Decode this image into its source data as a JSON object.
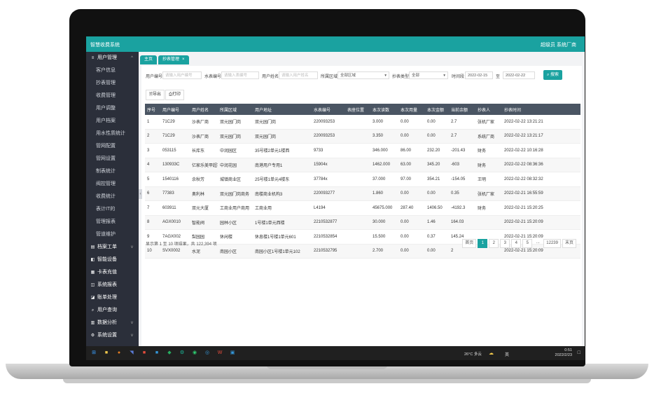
{
  "app": {
    "title": "智慧收费系统",
    "user": "超级员 系统厂商"
  },
  "colors": {
    "accent": "#1aa2a0",
    "sidebar": "#2b2f3a",
    "header": "#4a5563"
  },
  "sidebar": {
    "items": [
      {
        "label": "用户管理",
        "type": "group",
        "icon": "list-icon",
        "chev": "^"
      },
      {
        "label": "客户信息",
        "type": "sub"
      },
      {
        "label": "抄表管理",
        "type": "sub"
      },
      {
        "label": "收费管理",
        "type": "sub"
      },
      {
        "label": "用户调整",
        "type": "sub"
      },
      {
        "label": "用户档案",
        "type": "sub"
      },
      {
        "label": "用水性质统计",
        "type": "sub"
      },
      {
        "label": "管网配置",
        "type": "sub"
      },
      {
        "label": "管网设置",
        "type": "sub"
      },
      {
        "label": "制表统计",
        "type": "sub"
      },
      {
        "label": "阀控管理",
        "type": "sub"
      },
      {
        "label": "收费统计",
        "type": "sub"
      },
      {
        "label": "表计IT的",
        "type": "sub"
      },
      {
        "label": "管理报表",
        "type": "sub"
      },
      {
        "label": "管道维护",
        "type": "sub"
      },
      {
        "label": "档案工单",
        "type": "group",
        "icon": "doc-icon",
        "chev": "v"
      },
      {
        "label": "智能设备",
        "type": "group",
        "icon": "device-icon"
      },
      {
        "label": "卡表充值",
        "type": "group",
        "icon": "card-icon"
      },
      {
        "label": "系统报表",
        "type": "group",
        "icon": "report-icon"
      },
      {
        "label": "账单处理",
        "type": "group",
        "icon": "bill-icon"
      },
      {
        "label": "用户查询",
        "type": "group",
        "icon": "search-icon"
      },
      {
        "label": "数据分析",
        "type": "group",
        "icon": "chart-icon",
        "chev": "v"
      },
      {
        "label": "系统设置",
        "type": "group",
        "icon": "gear-icon",
        "chev": "v"
      }
    ]
  },
  "tabs": [
    {
      "label": "主页"
    },
    {
      "label": "抄表管理",
      "close": "×"
    }
  ],
  "filters": {
    "user_no_label": "用户编号",
    "user_no_placeholder": "请输入用户编号",
    "meter_no_label": "水表编号",
    "meter_no_placeholder": "请输入表编号",
    "user_name_label": "用户姓名",
    "user_name_placeholder": "请输入用户姓名",
    "area_label": "所属区域",
    "area_value": "全部区域",
    "meter_type_label": "抄表类型",
    "meter_type_value": "全部",
    "date_label": "时间段",
    "date_from": "2022-02-15",
    "date_to": "2022-02-22",
    "date_sep": "至",
    "search": "搜索"
  },
  "toolbar": {
    "export": "导出",
    "print": "打印"
  },
  "table": {
    "headers": [
      "序号",
      "用户编号",
      "用户姓名",
      "所属区域",
      "用户地址",
      "水表编号",
      "表座位置",
      "本次读数",
      "本次用量",
      "本次金额",
      "当前余额",
      "抄表人",
      "抄表时间"
    ],
    "rows": [
      [
        "1",
        "71C29",
        "沙表厂商",
        "双元园门岗",
        "双元园门岗",
        "220093253",
        "",
        "3.000",
        "0.00",
        "0.00",
        "2.7",
        "张机厂家",
        "2022-02-22 13:21:21"
      ],
      [
        "2",
        "71C29",
        "沙表厂商",
        "双元园门岗",
        "双元园门岗",
        "220093253",
        "",
        "3.350",
        "0.00",
        "0.00",
        "2.7",
        "系统厂商",
        "2022-02-22 13:21:17"
      ],
      [
        "3",
        "053115",
        "长库东",
        "中润园区",
        "35号楼2单元1楼西",
        "9733",
        "",
        "346.000",
        "86.00",
        "232.20",
        "-201.43",
        "财务",
        "2022-02-22 10:16:28"
      ],
      [
        "4",
        "130933C",
        "亿家乐美甲超市",
        "中润花园",
        "南港用户专用1",
        "15904x",
        "",
        "1462.000",
        "63.00",
        "345.20",
        "-603",
        "财务",
        "2022-02-22 08:36:36"
      ],
      [
        "5",
        "1540116",
        "余秋芳",
        "城镇商业区",
        "25号楼1单元4楼东",
        "37784x",
        "",
        "37.000",
        "97.00",
        "354.21",
        "-154.05",
        "王明",
        "2022-02-22 08:32:32"
      ],
      [
        "6",
        "77383",
        "奥利林",
        "双元园门岗商务",
        "南楼商业机构3",
        "220093277",
        "",
        "1.860",
        "0.00",
        "0.00",
        "0.35",
        "张机厂家",
        "2022-02-21 16:55:59"
      ],
      [
        "7",
        "603911",
        "双元大厦",
        "工商业用户商用",
        "工商业用",
        "L4194",
        "",
        "45675.000",
        "287.40",
        "1406.50",
        "-4192.3",
        "财务",
        "2022-02-21 15:20:25"
      ],
      [
        "8",
        "AGX0010",
        "智能阀",
        "园林小区",
        "1号楼1单元西楼",
        "2210532877",
        "",
        "30.000",
        "0.00",
        "1.46",
        "164.03",
        "",
        "2022-02-21 15:20:09"
      ],
      [
        "9",
        "7AGX002",
        "梨园园",
        "休闲楼",
        "休息楼1号楼1单元601",
        "2210532854",
        "",
        "15.500",
        "0.00",
        "0.37",
        "145.24",
        "",
        "2022-02-21 15:20:09"
      ],
      [
        "10",
        "SVX0002",
        "水泥",
        "南园小区",
        "南园小区1号楼1单元102",
        "2210532795",
        "",
        "2.700",
        "0.00",
        "0.00",
        "2",
        "",
        "2022-02-21 15:20:09"
      ]
    ]
  },
  "pager": {
    "summary": "显示第 1 至 10 项结果，共 122,394 项",
    "prev": "首页",
    "pages": [
      "1",
      "2",
      "3",
      "4",
      "5"
    ],
    "ellipsis": "...",
    "last_page": "12239",
    "next": "末页"
  },
  "taskbar": {
    "weather": "26°C 多云",
    "lang": "英",
    "time": "0:51",
    "date": "2022/2/23"
  }
}
